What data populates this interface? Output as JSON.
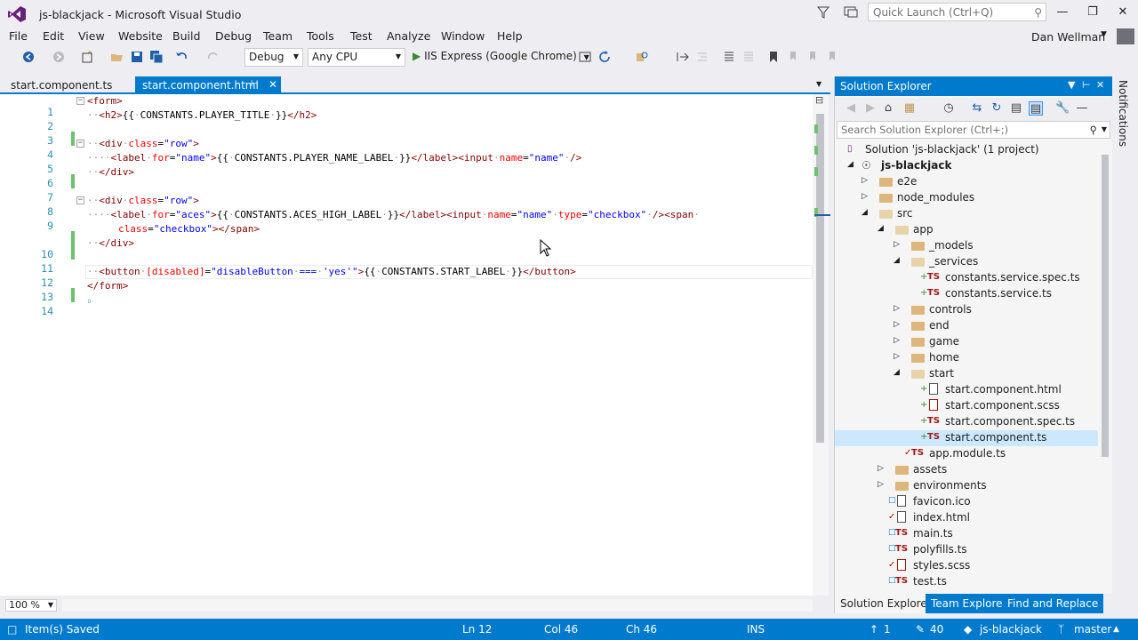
{
  "window": {
    "title": "js-blackjack - Microsoft Visual Studio",
    "quick_launch_placeholder": "Quick Launch (Ctrl+Q)",
    "minimize": "—",
    "restore": "❐",
    "close": "✕"
  },
  "menu": {
    "items": [
      "File",
      "Edit",
      "View",
      "Website",
      "Build",
      "Debug",
      "Team",
      "Tools",
      "Test",
      "Analyze",
      "Window",
      "Help"
    ],
    "user": "Dan Wellman"
  },
  "toolbar": {
    "configuration": "Debug",
    "platform": "Any CPU",
    "run_target": "IIS Express (Google Chrome)"
  },
  "tabs": {
    "inactive": "start.component.ts",
    "active": "start.component.html"
  },
  "editor": {
    "line_numbers": [
      "1",
      "2",
      "3",
      "4",
      "5",
      "6",
      "7",
      "8",
      "9",
      "10",
      "11",
      "12",
      "13",
      "14"
    ],
    "zoom": "100 %"
  },
  "solution_explorer": {
    "title": "Solution Explorer",
    "search_placeholder": "Search Solution Explorer (Ctrl+;)",
    "nodes": [
      "Solution 'js-blackjack' (1 project)",
      "js-blackjack",
      "e2e",
      "node_modules",
      "src",
      "app",
      "_models",
      "_services",
      "constants.service.spec.ts",
      "constants.service.ts",
      "controls",
      "end",
      "game",
      "home",
      "start",
      "start.component.html",
      "start.component.scss",
      "start.component.spec.ts",
      "start.component.ts",
      "app.module.ts",
      "assets",
      "environments",
      "favicon.ico",
      "index.html",
      "main.ts",
      "polyfills.ts",
      "styles.scss",
      "test.ts"
    ],
    "bottom_tabs": [
      "Solution Explorer",
      "Team Explorer",
      "Find and Replace"
    ]
  },
  "notifications": {
    "label": "Notifications"
  },
  "statusbar": {
    "message": "Item(s) Saved",
    "line": "Ln 12",
    "col": "Col 46",
    "ch": "Ch 46",
    "mode": "INS",
    "push_count": "1",
    "changes_count": "40",
    "repo": "js-blackjack",
    "branch": "master"
  },
  "colors": {
    "accent": "#007acc",
    "tag": "#800000",
    "attr": "#ff0000",
    "value": "#0000ff",
    "line_number": "#2b91af",
    "change_bar": "#6bc46d"
  }
}
